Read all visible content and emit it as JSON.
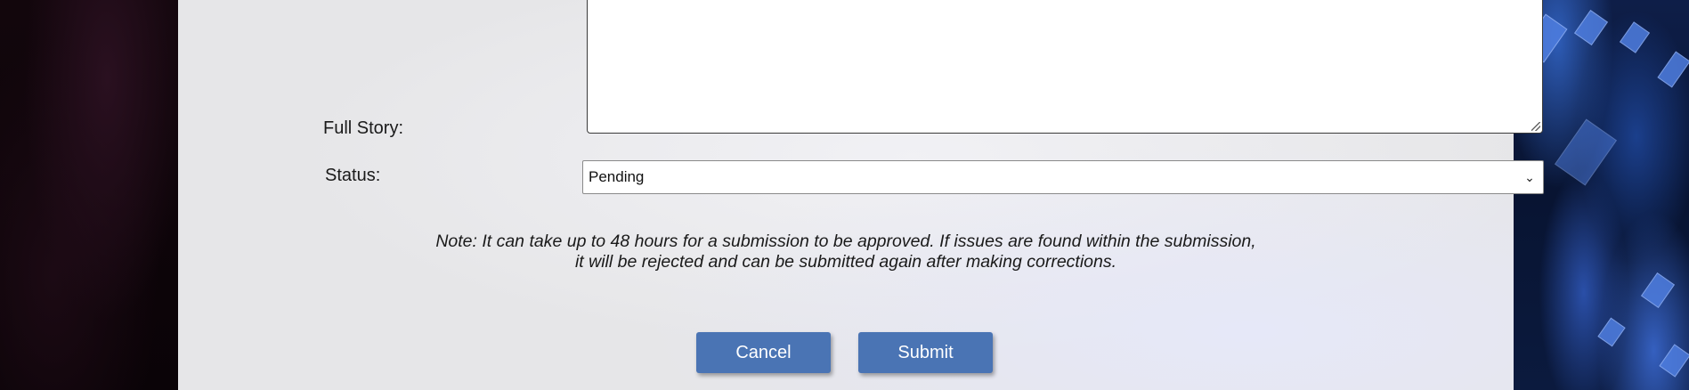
{
  "form": {
    "full_story_label": "Full Story:",
    "full_story_value": "",
    "status_label": "Status:",
    "status_value": "Pending",
    "note_line1": "Note: It can take up to 48 hours for a submission to be approved. If issues are found within the submission,",
    "note_line2": "it will be rejected and can be submitted again after making corrections.",
    "cancel_label": "Cancel",
    "submit_label": "Submit"
  },
  "colors": {
    "button_bg": "#4a74b4",
    "panel_bg": "#e6e6e8"
  },
  "icons": {
    "select_arrow": "chevron-down-icon",
    "resize": "resize-grip-icon"
  }
}
